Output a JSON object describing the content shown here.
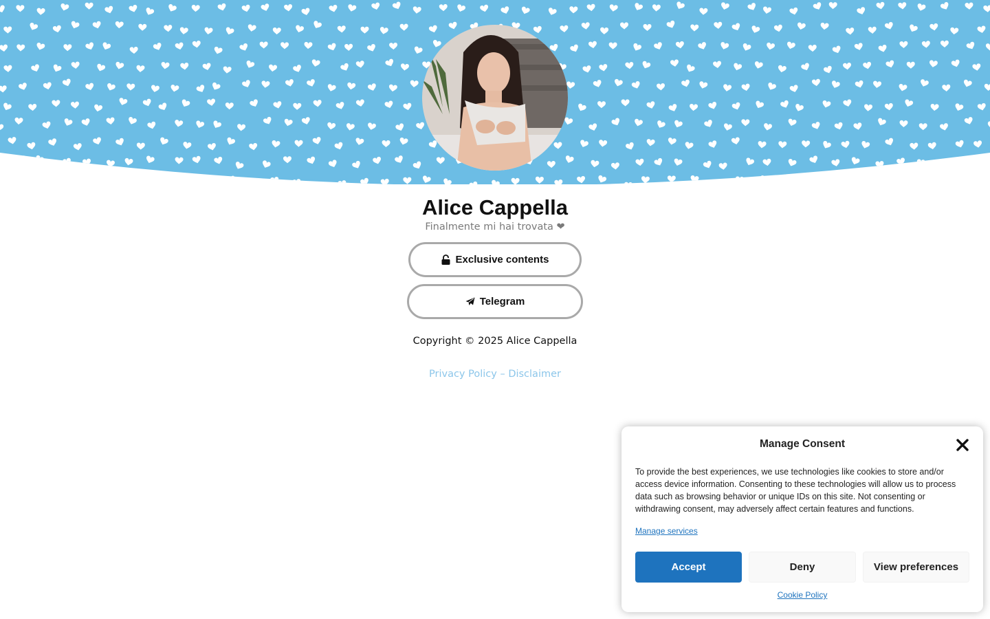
{
  "colors": {
    "banner_blue": "#6cbde5",
    "heart_white": "#ffffff",
    "button_border": "#a9a9a9",
    "link_color": "#8cc6ea",
    "accept_blue": "#1e73be",
    "tagline_gray": "#7a7a7a"
  },
  "profile": {
    "name": "Alice Cappella",
    "tagline": "Finalmente mi hai trovata ❤"
  },
  "links": [
    {
      "label": "Exclusive contents",
      "icon": "lock-open-icon"
    },
    {
      "label": "Telegram",
      "icon": "paper-plane-icon"
    }
  ],
  "footer": {
    "copyright": "Copyright © 2025 Alice Cappella",
    "privacy_label": "Privacy Policy",
    "separator": " – ",
    "disclaimer_label": "Disclaimer"
  },
  "consent": {
    "title": "Manage Consent",
    "close_icon": "close-icon",
    "body": "To provide the best experiences, we use technologies like cookies to store and/or access device information. Consenting to these technologies will allow us to process data such as browsing behavior or unique IDs on this site. Not consenting or withdrawing consent, may adversely affect certain features and functions.",
    "manage_services": "Manage services",
    "accept_label": "Accept",
    "deny_label": "Deny",
    "preferences_label": "View preferences",
    "cookie_policy": "Cookie Policy"
  }
}
